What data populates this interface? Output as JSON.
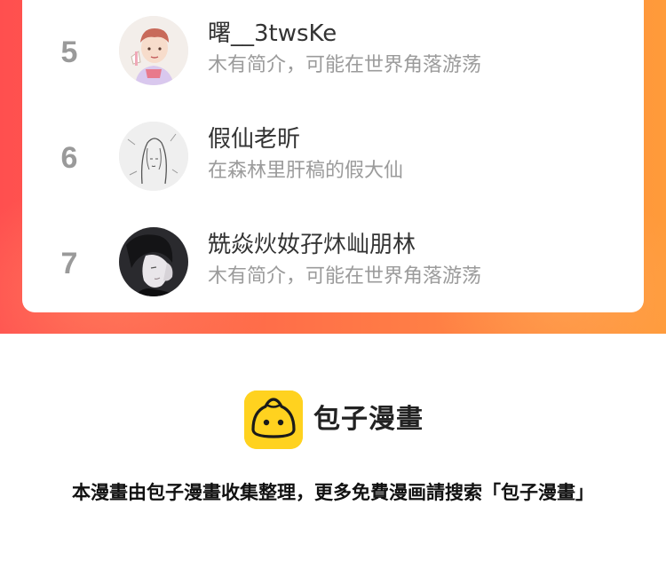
{
  "ranking": {
    "rows": [
      {
        "rank": "5",
        "name": "曙__3twsKe",
        "bio": "木有简介，可能在世界角落游荡",
        "avatar_icon": "boy-illustration-avatar"
      },
      {
        "rank": "6",
        "name": "假仙老昕",
        "bio": "在森林里肝稿的假大仙",
        "avatar_icon": "sketch-girl-avatar"
      },
      {
        "rank": "7",
        "name": "兟焱炏奻孖炑屾朋林",
        "bio": "木有简介，可能在世界角落游荡",
        "avatar_icon": "dark-portrait-avatar"
      }
    ]
  },
  "footer": {
    "brand_name": "包子漫畫",
    "brand_icon": "bun-logo-icon",
    "notice": "本漫畫由包子漫畫收集整理，更多免費漫画請搜索「包子漫畫」"
  },
  "colors": {
    "band_left": "#ff4f4f",
    "band_right": "#ff9b3a",
    "logo_yellow": "#ffd21f",
    "rank_gray": "#9a9a9a"
  }
}
